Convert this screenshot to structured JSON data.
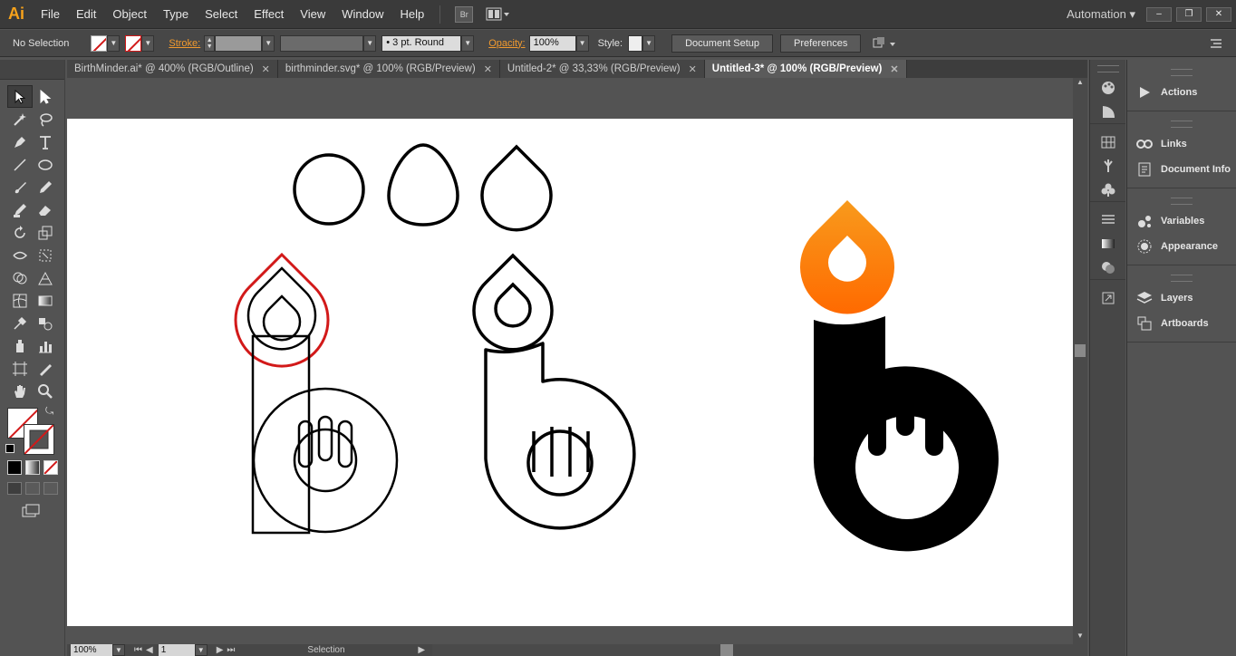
{
  "app": {
    "logo": "Ai",
    "workspace": "Automation ▾"
  },
  "menu": [
    "File",
    "Edit",
    "Object",
    "Type",
    "Select",
    "Effect",
    "View",
    "Window",
    "Help"
  ],
  "bridge_label": "Br",
  "window_controls": [
    "–",
    "❐",
    "✕"
  ],
  "control": {
    "selection_label": "No Selection",
    "stroke_label": "Stroke:",
    "brush_value": "3 pt. Round",
    "opacity_label": "Opacity:",
    "opacity_value": "100%",
    "style_label": "Style:",
    "document_setup": "Document Setup",
    "preferences": "Preferences"
  },
  "tabs": [
    {
      "label": "BirthMinder.ai* @ 400% (RGB/Outline)",
      "close": "✕"
    },
    {
      "label": "birthminder.svg* @ 100% (RGB/Preview)",
      "close": "✕"
    },
    {
      "label": "Untitled-2* @ 33,33% (RGB/Preview)",
      "close": "✕"
    },
    {
      "label": "Untitled-3* @ 100% (RGB/Preview)",
      "close": "✕"
    }
  ],
  "status": {
    "zoom": "100%",
    "page": "1",
    "tool_name": "Selection"
  },
  "panels": [
    [
      "Actions"
    ],
    [
      "Links",
      "Document Info"
    ],
    [
      "Variables",
      "Appearance"
    ],
    [
      "Layers",
      "Artboards"
    ]
  ],
  "colors": {
    "accent_orange": "#f29a2e",
    "stroke_red": "#d21919",
    "flame_top": "#f89a1c",
    "flame_bottom": "#ff6a00"
  }
}
